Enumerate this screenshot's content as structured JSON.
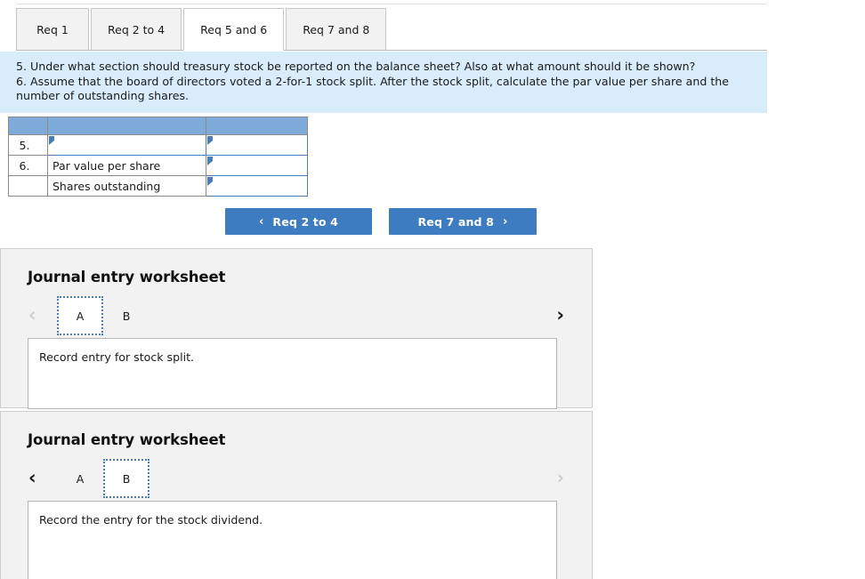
{
  "tabs": {
    "items": [
      {
        "label": "Req 1",
        "selected": false
      },
      {
        "label": "Req 2 to 4",
        "selected": false
      },
      {
        "label": "Req 5 and 6",
        "selected": true
      },
      {
        "label": "Req 7 and 8",
        "selected": false
      }
    ]
  },
  "question": {
    "line1": "5. Under what section should treasury stock be reported on the balance sheet? Also at what amount should it be shown?",
    "line2": "6. Assume that the board of directors voted a 2-for-1 stock split. After the stock split, calculate the par value per share and the number of outstanding shares."
  },
  "answer_table": {
    "header": [
      "",
      "",
      ""
    ],
    "rows": [
      {
        "num": "5.",
        "label": "",
        "label_is_input": true,
        "value": "",
        "value_is_input": true
      },
      {
        "num": "6.",
        "label": "Par value per share",
        "label_is_input": false,
        "value": "",
        "value_is_input": true
      },
      {
        "num": "",
        "label": "Shares outstanding",
        "label_is_input": false,
        "value": "",
        "value_is_input": true
      }
    ]
  },
  "nav": {
    "prev_label": "Req 2 to 4",
    "prev_icon": "chevron-left",
    "prev_glyph": "‹",
    "next_label": "Req 7 and 8",
    "next_icon": "chevron-right",
    "next_glyph": "›",
    "accent_color": "#3d7cc0"
  },
  "panels": [
    {
      "title": "Journal entry worksheet",
      "left_chevron": "‹",
      "left_enabled": false,
      "right_chevron": "›",
      "right_enabled": true,
      "letter_tabs": [
        {
          "label": "A",
          "selected": true
        },
        {
          "label": "B",
          "selected": false
        }
      ],
      "entry_text": "Record entry for stock split."
    },
    {
      "title": "Journal entry worksheet",
      "left_chevron": "‹",
      "left_enabled": true,
      "right_chevron": "›",
      "right_enabled": false,
      "letter_tabs": [
        {
          "label": "A",
          "selected": false
        },
        {
          "label": "B",
          "selected": true
        }
      ],
      "entry_text": "Record the entry for the stock dividend."
    }
  ],
  "colors": {
    "banner_bg": "#d9ecfa",
    "table_header_bg": "#7fabda",
    "input_border": "#4a7ebb",
    "button_bg": "#3d7cc0",
    "panel_bg": "#f2f2f2"
  }
}
